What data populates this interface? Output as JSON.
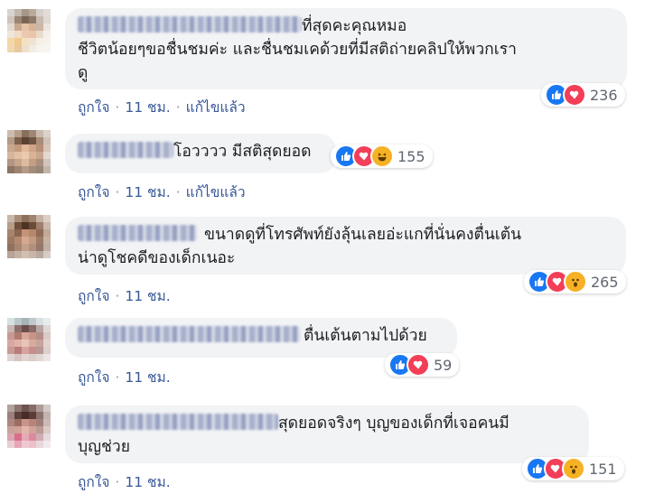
{
  "comments": [
    {
      "line1": "ที่สุดคะคุณหมอ",
      "line2": "ชีวิตน้อยๆขอชื่นชมค่ะ และชื่นชมเคด้วยที่มีสติถ่ายคลิปให้พวกเรา",
      "line3": "ดู",
      "reactions": [
        "like",
        "love"
      ],
      "count": "236",
      "like": "ถูกใจ",
      "sep1": "·",
      "time": "11 ชม.",
      "sep2": "·",
      "edited": "แก้ไขแล้ว"
    },
    {
      "line1": "โอวววว มีสติสุดยอด",
      "reactions": [
        "like",
        "love",
        "haha"
      ],
      "count": "155",
      "like": "ถูกใจ",
      "sep1": "·",
      "time": "11 ชม.",
      "sep2": "·",
      "edited": "แก้ไขแล้ว"
    },
    {
      "line1": "ขนาดดูที่โทรศัพท์ยังลุ้นเลยอ่ะแกที่นั่นคงตื่นเต้น",
      "line2": "น่าดูโชคดีของเด็กเนอะ",
      "reactions": [
        "like",
        "love",
        "wow"
      ],
      "count": "265",
      "like": "ถูกใจ",
      "sep1": "·",
      "time": "11 ชม."
    },
    {
      "line1": "ตื่นเต้นตามไปด้วย",
      "reactions": [
        "like",
        "love"
      ],
      "count": "59",
      "like": "ถูกใจ",
      "sep1": "·",
      "time": "11 ชม."
    },
    {
      "line1": "สุดยอดจริงๆ บุญของเด็กที่เจอคนมี",
      "line2": "บุญช่วย",
      "reactions": [
        "like",
        "love",
        "wow"
      ],
      "count": "151",
      "like": "ถูกใจ",
      "sep1": "·",
      "time": "11 ชม."
    }
  ],
  "colors": {
    "like": "#1877f2",
    "love": "#f33e58",
    "haha": "#f7b125",
    "wow": "#f7b125",
    "link": "#385898",
    "meta": "#606770",
    "bubble": "#f2f3f5"
  }
}
